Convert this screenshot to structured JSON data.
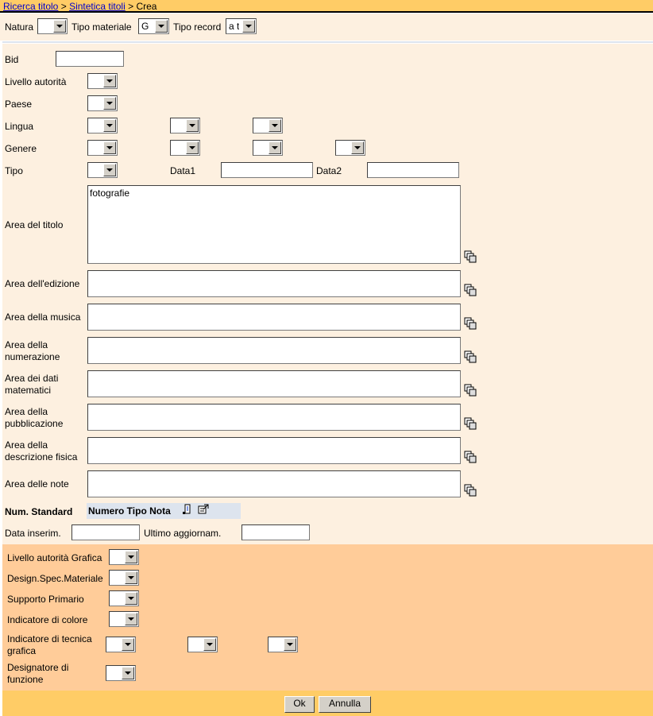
{
  "breadcrumb": {
    "link1": "Ricerca titolo",
    "sep1": ">",
    "link2": "Sintetica titoli",
    "sep2": ">",
    "current": "Crea"
  },
  "filters": {
    "natura_label": "Natura",
    "natura_value": "",
    "tipo_materiale_label": "Tipo materiale",
    "tipo_materiale_value": "G",
    "tipo_record_label": "Tipo record",
    "tipo_record_value": "a t"
  },
  "form": {
    "bid_label": "Bid",
    "livello_autorita_label": "Livello autorità",
    "paese_label": "Paese",
    "lingua_label": "Lingua",
    "genere_label": "Genere",
    "tipo_label": "Tipo",
    "data1_label": "Data1",
    "data2_label": "Data2",
    "area_titolo_label": "Area del titolo",
    "area_titolo_value": "fotografie",
    "area_edizione_label": "Area dell'edizione",
    "area_musica_label": "Area della musica",
    "area_numerazione_label": "Area della numerazione",
    "area_dati_matematici_label": "Area dei dati matematici",
    "area_pubblicazione_label": "Area della pubblicazione",
    "area_descrizione_fisica_label": "Area della descrizione fisica",
    "area_note_label": "Area delle note",
    "num_standard_label": "Num. Standard",
    "numero_tipo_nota_label": "Numero Tipo Nota",
    "data_inserim_label": "Data inserim.",
    "ultimo_aggiornam_label": "Ultimo aggiornam."
  },
  "grafica": {
    "livello_autorita_grafica_label": "Livello autorità Grafica",
    "design_spec_materiale_label": "Design.Spec.Materiale",
    "supporto_primario_label": "Supporto Primario",
    "indicatore_colore_label": "Indicatore di colore",
    "indicatore_tecnica_label": "Indicatore di tecnica grafica",
    "designatore_funzione_label": "Designatore di funzione"
  },
  "footer": {
    "ok_label": "Ok",
    "annulla_label": "Annulla"
  },
  "icons": {
    "copy": "copy-icon",
    "add": "add-row-icon",
    "edit": "edit-row-icon"
  }
}
